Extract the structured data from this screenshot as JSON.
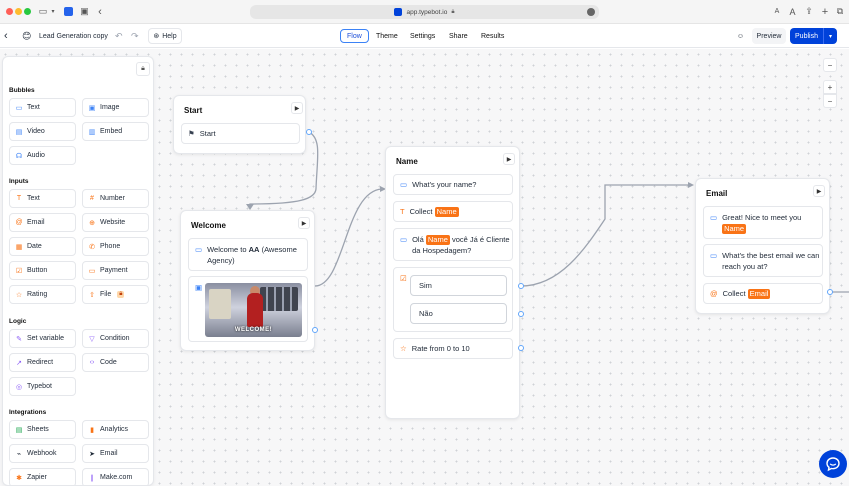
{
  "browser": {
    "url": "app.typebot.io",
    "right_icons": [
      "A",
      "A"
    ]
  },
  "header": {
    "title": "Lead Generation copy",
    "help": "Help",
    "tabs": [
      "Flow",
      "Theme",
      "Settings",
      "Share",
      "Results"
    ],
    "active_tab": "Flow",
    "preview": "Preview",
    "publish": "Publish"
  },
  "sidebar": {
    "sections": {
      "bubbles": "Bubbles",
      "inputs": "Inputs",
      "logic": "Logic",
      "integrations": "Integrations"
    },
    "bubbles": [
      "Text",
      "Image",
      "Video",
      "Embed",
      "Audio"
    ],
    "inputs": [
      "Text",
      "Number",
      "Email",
      "Website",
      "Date",
      "Phone",
      "Button",
      "Payment",
      "Rating",
      "File"
    ],
    "logic": [
      "Set variable",
      "Condition",
      "Redirect",
      "Code",
      "Typebot"
    ],
    "integrations": [
      "Sheets",
      "Analytics",
      "Webhook",
      "Email",
      "Zapier",
      "Make.com"
    ]
  },
  "canvas": {
    "zoom_controls": [
      "−",
      "+",
      "−"
    ]
  },
  "groups": {
    "start": {
      "title": "Start",
      "block": "Start"
    },
    "welcome": {
      "title": "Welcome",
      "text_prefix": "Welcome to ",
      "text_bold": "AA",
      "text_suffix": " (Awesome Agency)",
      "gif_caption": "WELCOME!"
    },
    "name": {
      "title": "Name",
      "question": "What's your name?",
      "collect_prefix": "Collect",
      "collect_var": "Name",
      "greeting_prefix": "Olá",
      "greeting_var": "Name",
      "greeting_suffix": "você Já é Cliente da Hospedagem?",
      "choices": [
        "Sim",
        "Não"
      ],
      "rating": "Rate from 0 to 10"
    },
    "email": {
      "title": "Email",
      "greeting_prefix": "Great! Nice to meet you",
      "greeting_var": "Name",
      "question": "What's the best email we can reach you at?",
      "collect_prefix": "Collect",
      "collect_var": "Email"
    }
  },
  "colors": {
    "accent": "#0042da",
    "variable": "#f97316",
    "port": "#60a5fa"
  }
}
